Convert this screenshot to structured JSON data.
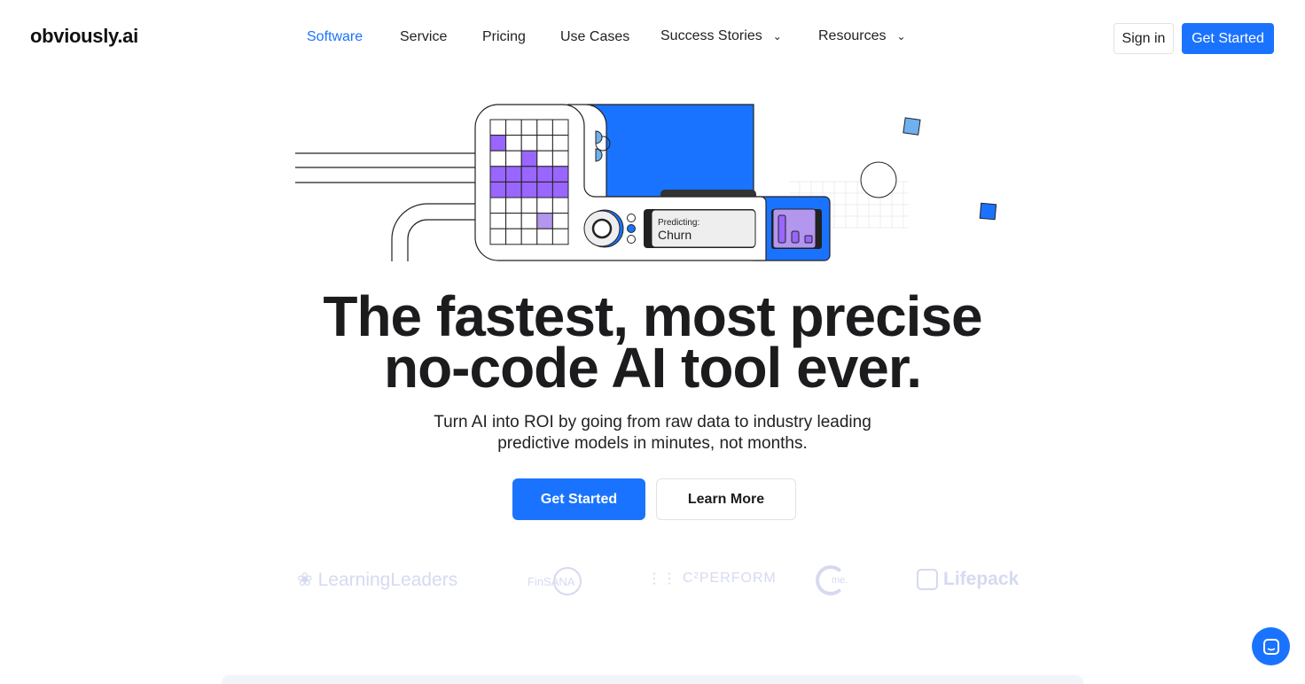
{
  "brand": {
    "logo_text": "obviously.ai"
  },
  "nav": {
    "items": [
      {
        "label": "Software",
        "active": true
      },
      {
        "label": "Service"
      },
      {
        "label": "Pricing"
      },
      {
        "label": "Use Cases"
      },
      {
        "label": "Success Stories",
        "dropdown": true
      },
      {
        "label": "Resources",
        "dropdown": true
      }
    ],
    "sign_in": "Sign in",
    "get_started": "Get Started"
  },
  "illustration": {
    "predicting_label": "Predicting:",
    "predicting_value": "Churn"
  },
  "hero": {
    "title_line1": "The fastest, most precise",
    "title_line2": "no-code AI tool ever.",
    "subtitle": "Turn AI into ROI by going from raw data to industry leading predictive models in minutes, not months.",
    "primary_cta": "Get Started",
    "secondary_cta": "Learn More"
  },
  "customer_logos": [
    "LearningLeaders",
    "FinSANA",
    "C²PERFORM",
    "me.",
    "Lifepack"
  ],
  "colors": {
    "accent": "#1a73ff",
    "purple": "#9966ff",
    "logo_gray": "#d6daf0"
  }
}
